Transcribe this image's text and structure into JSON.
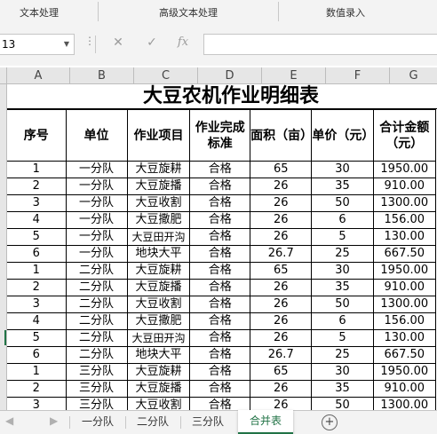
{
  "ribbon": {
    "groups": [
      "文本处理",
      "高级文本处理",
      "数值录入"
    ]
  },
  "formula_bar": {
    "name_box": "13",
    "cancel_icon": "✕",
    "confirm_icon": "✓",
    "fx_label": "fx",
    "value": ""
  },
  "columns": [
    "A",
    "B",
    "C",
    "D",
    "E",
    "F",
    "G"
  ],
  "sheet": {
    "title": "大豆农机作业明细表",
    "headers": [
      "序号",
      "单位",
      "作业项目",
      "作业完成标准",
      "面积（亩）",
      "单价（元）",
      "合计金额（元）"
    ],
    "rows": [
      [
        "1",
        "一分队",
        "大豆旋耕",
        "合格",
        "65",
        "30",
        "1950.00"
      ],
      [
        "2",
        "一分队",
        "大豆旋播",
        "合格",
        "26",
        "35",
        "910.00"
      ],
      [
        "3",
        "一分队",
        "大豆收割",
        "合格",
        "26",
        "50",
        "1300.00"
      ],
      [
        "4",
        "一分队",
        "大豆撒肥",
        "合格",
        "26",
        "6",
        "156.00"
      ],
      [
        "5",
        "一分队",
        "大豆田开沟",
        "合格",
        "26",
        "5",
        "130.00"
      ],
      [
        "6",
        "一分队",
        "地块大平",
        "合格",
        "26.7",
        "25",
        "667.50"
      ],
      [
        "1",
        "二分队",
        "大豆旋耕",
        "合格",
        "65",
        "30",
        "1950.00"
      ],
      [
        "2",
        "二分队",
        "大豆旋播",
        "合格",
        "26",
        "35",
        "910.00"
      ],
      [
        "3",
        "二分队",
        "大豆收割",
        "合格",
        "26",
        "50",
        "1300.00"
      ],
      [
        "4",
        "二分队",
        "大豆撒肥",
        "合格",
        "26",
        "6",
        "156.00"
      ],
      [
        "5",
        "二分队",
        "大豆田开沟",
        "合格",
        "26",
        "5",
        "130.00"
      ],
      [
        "6",
        "二分队",
        "地块大平",
        "合格",
        "26.7",
        "25",
        "667.50"
      ],
      [
        "1",
        "三分队",
        "大豆旋耕",
        "合格",
        "65",
        "30",
        "1950.00"
      ],
      [
        "2",
        "三分队",
        "大豆旋播",
        "合格",
        "26",
        "35",
        "910.00"
      ],
      [
        "3",
        "三分队",
        "大豆收割",
        "合格",
        "26",
        "50",
        "1300.00"
      ]
    ]
  },
  "tabs": {
    "prev_icon": "◀",
    "next_icon": "▶",
    "items": [
      "一分队",
      "二分队",
      "三分队",
      "合并表"
    ],
    "active": "合并表",
    "add_icon": "+"
  },
  "colors": {
    "accent": "#217346",
    "header_bg": "#e6e6e6",
    "toolbar_bg": "#f3f3f3"
  }
}
